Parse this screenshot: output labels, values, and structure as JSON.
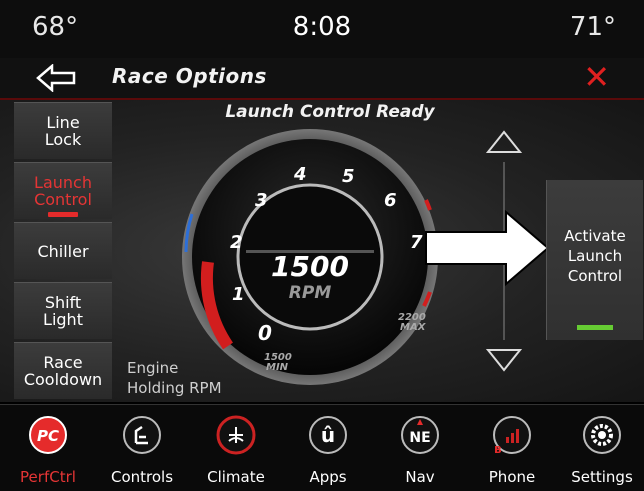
{
  "status": {
    "left_temp": "68°",
    "time": "8:08",
    "right_temp": "71°"
  },
  "header": {
    "title": "Race Options",
    "back_icon": "back-arrow-icon",
    "close_icon": "close-icon"
  },
  "sidebar": {
    "items": [
      {
        "label": "Line\nLock"
      },
      {
        "label": "Launch\nControl",
        "active": true
      },
      {
        "label": "Chiller"
      },
      {
        "label": "Shift\nLight"
      },
      {
        "label": "Race\nCooldown"
      }
    ]
  },
  "main": {
    "status_title": "Launch Control Ready",
    "gauge": {
      "rpm_value": "1500",
      "rpm_unit": "RPM",
      "ticks": [
        "0",
        "1",
        "2",
        "3",
        "4",
        "5",
        "6",
        "7"
      ],
      "min_label": "1500\nMIN",
      "max_label": "2200\nMAX"
    },
    "engine_label": "Engine\nHolding RPM",
    "activate_button": "Activate\nLaunch\nControl",
    "accent_red": "#e52b2b",
    "accent_green": "#66cc33"
  },
  "nav": {
    "items": [
      {
        "label": "PerfCtrl",
        "icon": "pc-icon",
        "active": true
      },
      {
        "label": "Controls",
        "icon": "heated-seat-icon"
      },
      {
        "label": "Climate",
        "icon": "climate-icon"
      },
      {
        "label": "Apps",
        "icon": "apps-icon"
      },
      {
        "label": "Nav",
        "icon": "compass-icon",
        "compass": "NE"
      },
      {
        "label": "Phone",
        "icon": "phone-icon"
      },
      {
        "label": "Settings",
        "icon": "gear-icon"
      }
    ]
  }
}
